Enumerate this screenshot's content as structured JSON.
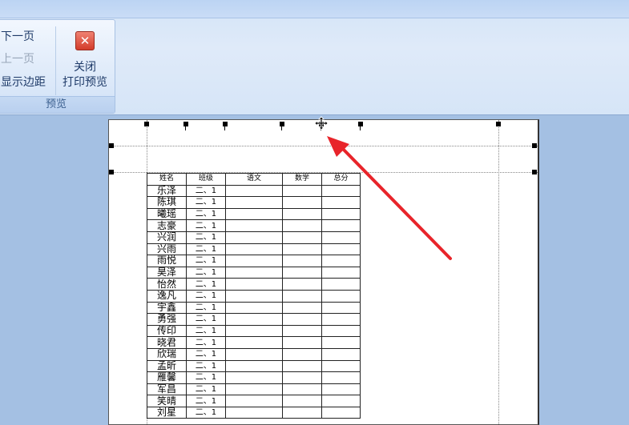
{
  "ribbon": {
    "next_page": "下一页",
    "prev_page": "上一页",
    "show_margins": "显示边距",
    "close_line1": "关闭",
    "close_line2": "打印预览",
    "group_label": "预览"
  },
  "table": {
    "headers": [
      "姓名",
      "班级",
      "语文",
      "数学",
      "总分"
    ],
    "rows": [
      [
        "乐泽",
        "二、1"
      ],
      [
        "陈琪",
        "二、1"
      ],
      [
        "曦瑶",
        "二、1"
      ],
      [
        "志豪",
        "二、1"
      ],
      [
        "兴润",
        "二、1"
      ],
      [
        "兴雨",
        "二、1"
      ],
      [
        "雨悦",
        "二、1"
      ],
      [
        "昊泽",
        "二、1"
      ],
      [
        "怡然",
        "二、1"
      ],
      [
        "逸凡",
        "二、1"
      ],
      [
        "宇鑫",
        "二、1"
      ],
      [
        "勇强",
        "二、1"
      ],
      [
        "传印",
        "二、1"
      ],
      [
        "晓君",
        "二、1"
      ],
      [
        "欣瑞",
        "二、1"
      ],
      [
        "孟昕",
        "二、1"
      ],
      [
        "雁馨",
        "二、1"
      ],
      [
        "军昌",
        "二、1"
      ],
      [
        "笑晴",
        "二、1"
      ],
      [
        "刘星",
        "二、1"
      ]
    ]
  },
  "colors": {
    "arrow": "#e8242a",
    "close_icon": "#d33c2a"
  }
}
